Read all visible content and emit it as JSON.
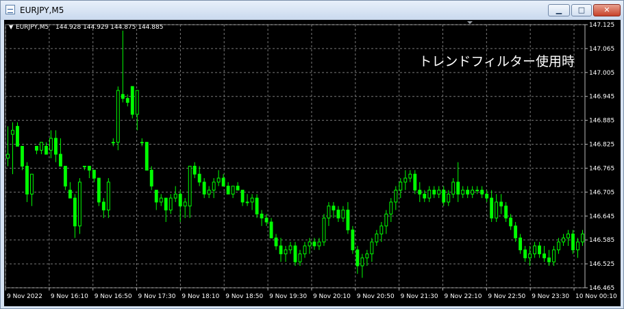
{
  "window": {
    "title": "EURJPY,M5",
    "minimize_glyph": "▁",
    "maximize_glyph": "□",
    "close_glyph": "✕"
  },
  "chart_header": {
    "collapse_glyph": "▼",
    "symbol_label": "EURJPY,M5",
    "ohlc_label": "144.928 144.929 144.875 144.885"
  },
  "annotation": "トレンドフィルター使用時",
  "colors": {
    "background": "#000000",
    "grid": "#7a7a7a",
    "candle": "#00ff00",
    "text": "#ffffff",
    "window_frame": "#d6e3f3",
    "close_button": "#c7422a"
  },
  "chart_data": {
    "type": "candlestick",
    "timeframe": "M5",
    "ylim": [
      146.465,
      147.125
    ],
    "y_ticks": [
      "147.125",
      "147.065",
      "147.005",
      "146.945",
      "146.885",
      "146.825",
      "146.765",
      "146.705",
      "146.645",
      "146.585",
      "146.525",
      "146.465"
    ],
    "x_ticks": [
      "9 Nov 2022",
      "9 Nov 16:10",
      "9 Nov 16:50",
      "9 Nov 17:30",
      "9 Nov 18:10",
      "9 Nov 18:50",
      "9 Nov 19:30",
      "9 Nov 20:10",
      "9 Nov 20:50",
      "9 Nov 21:30",
      "9 Nov 22:10",
      "9 Nov 22:50",
      "9 Nov 23:30",
      "10 Nov 00:10"
    ],
    "grid": true,
    "candles": [
      [
        146.79,
        146.87,
        146.77,
        146.8
      ],
      [
        146.85,
        146.88,
        146.75,
        146.86
      ],
      [
        146.87,
        146.88,
        146.82,
        146.82
      ],
      [
        146.82,
        146.82,
        146.76,
        146.77
      ],
      [
        146.77,
        146.78,
        146.68,
        146.7
      ],
      [
        146.7,
        146.75,
        146.67,
        146.75
      ],
      [
        146.82,
        146.82,
        146.8,
        146.81
      ],
      [
        146.81,
        146.83,
        146.8,
        146.83
      ],
      [
        146.82,
        146.83,
        146.8,
        146.8
      ],
      [
        146.81,
        146.86,
        146.79,
        146.84
      ],
      [
        146.84,
        146.86,
        146.78,
        146.8
      ],
      [
        146.8,
        146.84,
        146.77,
        146.77
      ],
      [
        146.77,
        146.77,
        146.71,
        146.72
      ],
      [
        146.71,
        146.73,
        146.69,
        146.69
      ],
      [
        146.69,
        146.7,
        146.59,
        146.62
      ],
      [
        146.62,
        146.74,
        146.6,
        146.73
      ],
      [
        146.77,
        146.77,
        146.76,
        146.77
      ],
      [
        146.77,
        146.77,
        146.74,
        146.76
      ],
      [
        146.76,
        146.76,
        146.73,
        146.74
      ],
      [
        146.74,
        146.74,
        146.67,
        146.68
      ],
      [
        146.68,
        146.69,
        146.64,
        146.66
      ],
      [
        146.66,
        146.74,
        146.64,
        146.73
      ],
      [
        146.83,
        146.84,
        146.82,
        146.83
      ],
      [
        146.83,
        146.97,
        146.81,
        146.96
      ],
      [
        146.95,
        147.11,
        146.93,
        146.94
      ],
      [
        146.94,
        146.95,
        146.92,
        146.93
      ],
      [
        146.97,
        146.97,
        146.89,
        146.9
      ],
      [
        146.9,
        146.96,
        146.86,
        146.96
      ],
      [
        146.83,
        146.84,
        146.82,
        146.83
      ],
      [
        146.83,
        146.83,
        146.76,
        146.76
      ],
      [
        146.76,
        146.77,
        146.71,
        146.72
      ],
      [
        146.71,
        146.71,
        146.66,
        146.68
      ],
      [
        146.68,
        146.7,
        146.67,
        146.69
      ],
      [
        146.69,
        146.69,
        146.63,
        146.66
      ],
      [
        146.66,
        146.7,
        146.65,
        146.69
      ],
      [
        146.69,
        146.72,
        146.68,
        146.7
      ],
      [
        146.7,
        146.71,
        146.63,
        146.67
      ],
      [
        146.67,
        146.69,
        146.64,
        146.68
      ],
      [
        146.67,
        146.71,
        146.64,
        146.77
      ],
      [
        146.77,
        146.78,
        146.74,
        146.75
      ],
      [
        146.75,
        146.77,
        146.72,
        146.73
      ],
      [
        146.73,
        146.74,
        146.69,
        146.7
      ],
      [
        146.7,
        146.72,
        146.69,
        146.71
      ],
      [
        146.71,
        146.74,
        146.69,
        146.73
      ],
      [
        146.73,
        146.76,
        146.72,
        146.74
      ],
      [
        146.74,
        146.75,
        146.72,
        146.72
      ],
      [
        146.72,
        146.73,
        146.7,
        146.7
      ],
      [
        146.7,
        146.72,
        146.69,
        146.72
      ],
      [
        146.72,
        146.73,
        146.71,
        146.71
      ],
      [
        146.71,
        146.71,
        146.67,
        146.68
      ],
      [
        146.68,
        146.7,
        146.67,
        146.68
      ],
      [
        146.68,
        146.7,
        146.66,
        146.69
      ],
      [
        146.69,
        146.7,
        146.64,
        146.65
      ],
      [
        146.65,
        146.66,
        146.62,
        146.64
      ],
      [
        146.64,
        146.65,
        146.62,
        146.63
      ],
      [
        146.63,
        146.64,
        146.59,
        146.59
      ],
      [
        146.59,
        146.6,
        146.56,
        146.57
      ],
      [
        146.57,
        146.59,
        146.53,
        146.55
      ],
      [
        146.55,
        146.57,
        146.53,
        146.56
      ],
      [
        146.56,
        146.58,
        146.55,
        146.57
      ],
      [
        146.57,
        146.58,
        146.52,
        146.53
      ],
      [
        146.53,
        146.56,
        146.52,
        146.55
      ],
      [
        146.55,
        146.58,
        146.54,
        146.57
      ],
      [
        146.57,
        146.59,
        146.55,
        146.58
      ],
      [
        146.58,
        146.59,
        146.56,
        146.57
      ],
      [
        146.57,
        146.59,
        146.56,
        146.58
      ],
      [
        146.58,
        146.65,
        146.57,
        146.64
      ],
      [
        146.64,
        146.68,
        146.62,
        146.67
      ],
      [
        146.67,
        146.68,
        146.64,
        146.66
      ],
      [
        146.66,
        146.67,
        146.63,
        146.64
      ],
      [
        146.64,
        146.67,
        146.63,
        146.66
      ],
      [
        146.66,
        146.68,
        146.6,
        146.61
      ],
      [
        146.61,
        146.62,
        146.55,
        146.56
      ],
      [
        146.56,
        146.57,
        146.5,
        146.52
      ],
      [
        146.52,
        146.55,
        146.49,
        146.54
      ],
      [
        146.54,
        146.56,
        146.52,
        146.55
      ],
      [
        146.55,
        146.59,
        146.53,
        146.58
      ],
      [
        146.58,
        146.61,
        146.57,
        146.6
      ],
      [
        146.6,
        146.63,
        146.58,
        146.62
      ],
      [
        146.62,
        146.66,
        146.6,
        146.65
      ],
      [
        146.65,
        146.69,
        146.63,
        146.68
      ],
      [
        146.68,
        146.72,
        146.66,
        146.71
      ],
      [
        146.71,
        146.74,
        146.69,
        146.73
      ],
      [
        146.73,
        146.76,
        146.71,
        146.74
      ],
      [
        146.74,
        146.76,
        146.73,
        146.75
      ],
      [
        146.75,
        146.76,
        146.7,
        146.71
      ],
      [
        146.71,
        146.73,
        146.68,
        146.7
      ],
      [
        146.7,
        146.71,
        146.68,
        146.69
      ],
      [
        146.69,
        146.72,
        146.68,
        146.71
      ],
      [
        146.71,
        146.72,
        146.69,
        146.7
      ],
      [
        146.7,
        146.72,
        146.69,
        146.71
      ],
      [
        146.71,
        146.72,
        146.67,
        146.68
      ],
      [
        146.68,
        146.71,
        146.67,
        146.7
      ],
      [
        146.7,
        146.74,
        146.69,
        146.73
      ],
      [
        146.73,
        146.78,
        146.68,
        146.7
      ],
      [
        146.7,
        146.72,
        146.69,
        146.71
      ],
      [
        146.71,
        146.72,
        146.69,
        146.7
      ],
      [
        146.7,
        146.72,
        146.69,
        146.71
      ],
      [
        146.71,
        146.72,
        146.7,
        146.71
      ],
      [
        146.71,
        146.72,
        146.69,
        146.7
      ],
      [
        146.7,
        146.71,
        146.68,
        146.69
      ],
      [
        146.69,
        146.71,
        146.63,
        146.64
      ],
      [
        146.64,
        146.7,
        146.63,
        146.68
      ],
      [
        146.68,
        146.7,
        146.65,
        146.67
      ],
      [
        146.67,
        146.68,
        146.63,
        146.64
      ],
      [
        146.64,
        146.65,
        146.61,
        146.62
      ],
      [
        146.62,
        146.63,
        146.58,
        146.59
      ],
      [
        146.59,
        146.6,
        146.55,
        146.56
      ],
      [
        146.56,
        146.57,
        146.53,
        146.54
      ],
      [
        146.54,
        146.57,
        146.52,
        146.55
      ],
      [
        146.55,
        146.58,
        146.54,
        146.57
      ],
      [
        146.57,
        146.58,
        146.54,
        146.55
      ],
      [
        146.55,
        146.57,
        146.53,
        146.54
      ],
      [
        146.54,
        146.56,
        146.52,
        146.53
      ],
      [
        146.53,
        146.57,
        146.52,
        146.56
      ],
      [
        146.56,
        146.59,
        146.55,
        146.58
      ],
      [
        146.58,
        146.6,
        146.57,
        146.59
      ],
      [
        146.59,
        146.61,
        146.57,
        146.6
      ],
      [
        146.6,
        146.61,
        146.55,
        146.56
      ],
      [
        146.56,
        146.59,
        146.54,
        146.58
      ],
      [
        146.58,
        146.61,
        146.57,
        146.6
      ]
    ]
  }
}
